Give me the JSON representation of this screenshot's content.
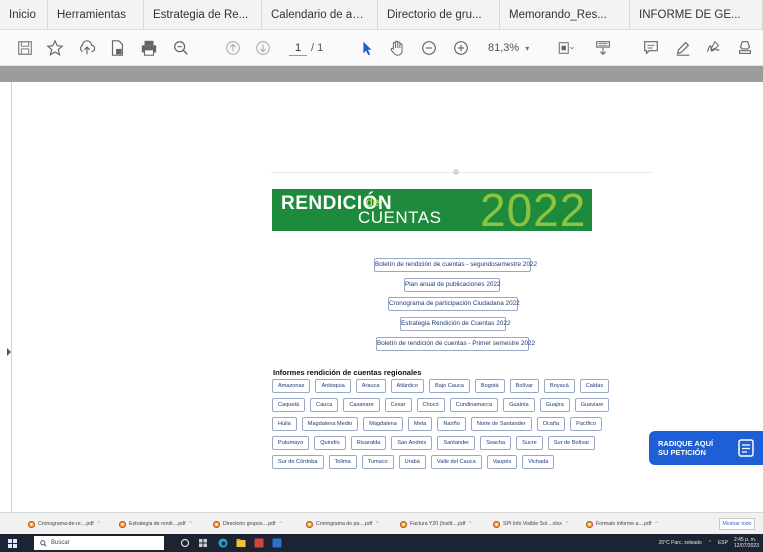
{
  "tabs": [
    "Inicio",
    "Herramientas",
    "Estrategia de Re...",
    "Calendario de au...",
    "Directorio de gru...",
    "Memorando_Res...",
    "INFORME DE GE..."
  ],
  "toolbar": {
    "page_current": "1",
    "page_total": "/ 1",
    "zoom": "81,3%",
    "zoom_caret": "▾"
  },
  "banner": {
    "rendicion": "RENDICIÓN",
    "de": "de",
    "cuentas": "CUENTAS",
    "year": "2022"
  },
  "documents": [
    "Boletín de rendición de cuentas - segundosemestre 2022",
    "Plan anual de publicaciones 2022",
    "Cronograma de participación Ciudadana 2022",
    "Estrategia Rendición de Cuentas 2022",
    "Boletín de rendición de cuentas - Primer semestre 2022"
  ],
  "regional": {
    "title": "Informes rendición de cuentas regionales",
    "rows": [
      [
        "Amazonas",
        "Antioquia",
        "Arauca",
        "Atlántico",
        "Bajo Cauca",
        "Bogotá",
        "Bolívar",
        "Boyacá",
        "Caldas"
      ],
      [
        "Caquetá",
        "Cauca",
        "Casanare",
        "Cesar",
        "Chocó",
        "Cundinamarca",
        "Guainía",
        "Guajira",
        "Guaviare"
      ],
      [
        "Huila",
        "Magdalena Medio",
        "Magdalena",
        "Meta",
        "Nariño",
        "Norte de Santander",
        "Ocaña",
        "Pacífico"
      ],
      [
        "Putumayo",
        "Quindío",
        "Risaralda",
        "San Andrés",
        "Santander",
        "Soacha",
        "Sucre",
        "Sur de Bolívar"
      ],
      [
        "Sur de Córdoba",
        "Tolima",
        "Tumaco",
        "Urabá",
        "Valle del Cauca",
        "Vaupés",
        "Vichada"
      ]
    ]
  },
  "cta": {
    "line1": "RADIQUE AQUÍ",
    "line2": "SU PETICIÓN"
  },
  "downloads": [
    "Cronograma-de-re....pdf",
    "Estrategia de rendi....pdf",
    "Directorio grupos....pdf",
    "Cronograma de pa....pdf",
    "Factura Y20 (Instit....pdf",
    "SPI Info Visible Sol....xlsx",
    "Formato informe a....pdf"
  ],
  "downloads_show_all": "Mostrar todo",
  "taskbar": {
    "search_placeholder": "Buscar",
    "weather": "20°C  Parc. soleado",
    "lang": "ESP",
    "time": "2:45 p. m.",
    "date": "12/07/2023"
  },
  "colors": {
    "banner_green": "#1e8a3b",
    "banner_year": "#8cc43f",
    "banner_de": "#d2e84a",
    "pill_border": "#9aa8c8",
    "pill_text": "#1e3a78",
    "cta_blue": "#1f5fd6"
  },
  "icons": [
    "save-icon",
    "bookmark-star-icon",
    "upload-icon",
    "document-icon",
    "print-icon",
    "zoom-search-icon",
    "page-up-icon",
    "page-down-icon",
    "cursor-icon",
    "hand-icon",
    "zoom-out-icon",
    "zoom-in-icon",
    "fit-page-icon",
    "scroll-mode-icon",
    "comment-icon",
    "pen-icon",
    "sign-icon",
    "stamp-icon",
    "form-icon"
  ]
}
